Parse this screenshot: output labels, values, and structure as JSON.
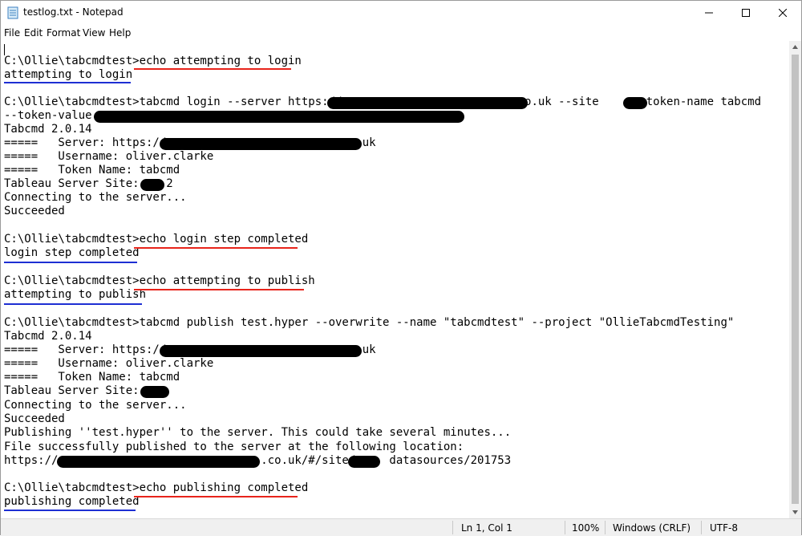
{
  "window": {
    "title": "testlog.txt - Notepad"
  },
  "menu": [
    "File",
    "Edit",
    "Format",
    "View",
    "Help"
  ],
  "lines": [
    "",
    "C:\\Ollie\\tabcmdtest>echo attempting to login",
    "attempting to login",
    "",
    "C:\\Ollie\\tabcmdtest>tabcmd login --server https://                         .co.uk --site     --token-name tabcmd",
    "--token-value",
    "Tabcmd 2.0.14",
    "=====   Server: https://                         .co.uk",
    "=====   Username: oliver.clarke",
    "=====   Token Name: tabcmd",
    "Tableau Server Site:    2",
    "Connecting to the server...",
    "Succeeded",
    "",
    "C:\\Ollie\\tabcmdtest>echo login step completed",
    "login step completed",
    "",
    "C:\\Ollie\\tabcmdtest>echo attempting to publish",
    "attempting to publish",
    "",
    "C:\\Ollie\\tabcmdtest>tabcmd publish test.hyper --overwrite --name \"tabcmdtest\" --project \"OllieTabcmdTesting\"",
    "Tabcmd 2.0.14",
    "=====   Server: https://                         .co.uk",
    "=====   Username: oliver.clarke",
    "=====   Token Name: tabcmd",
    "Tableau Server Site:",
    "Connecting to the server...",
    "Succeeded",
    "Publishing ''test.hyper'' to the server. This could take several minutes...",
    "File successfully published to the server at the following location:",
    "https://                              .co.uk/#/site/     datasources/201753",
    "",
    "C:\\Ollie\\tabcmdtest>echo publishing completed",
    "publishing completed"
  ],
  "status": {
    "position": "Ln 1, Col 1",
    "zoom": "100%",
    "line_endings": "Windows (CRLF)",
    "encoding": "UTF-8"
  },
  "colors": {
    "red_underline": "#e8241b",
    "blue_underline": "#1e2fd3"
  }
}
